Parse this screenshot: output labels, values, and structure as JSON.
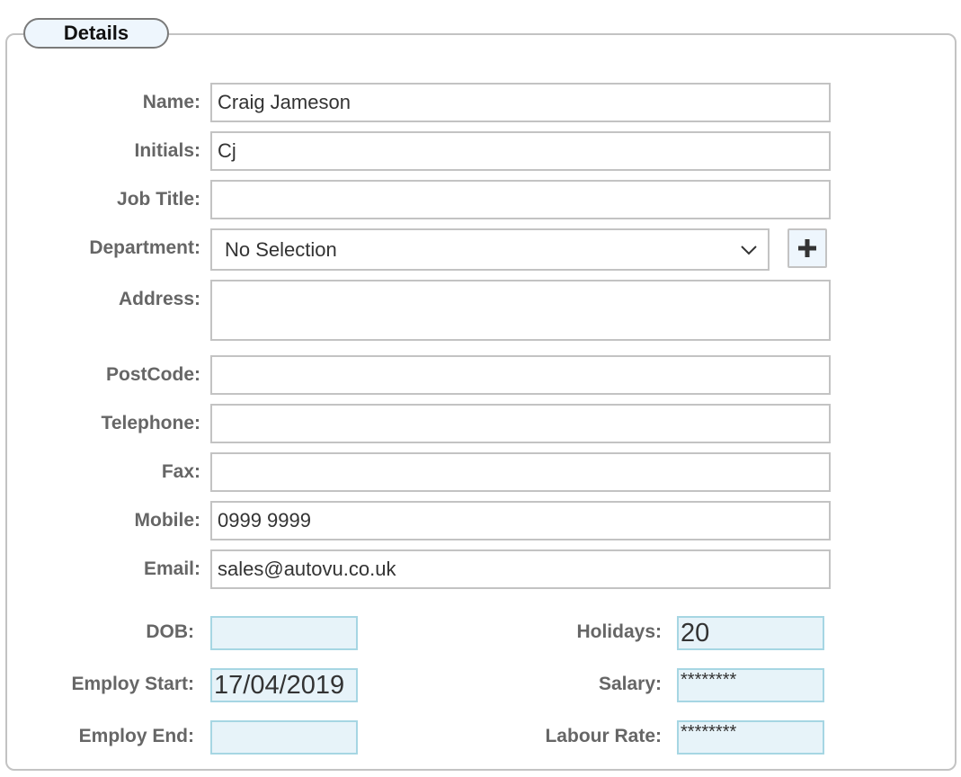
{
  "section": {
    "title": "Details"
  },
  "fields": {
    "name": {
      "label": "Name:",
      "value": "Craig Jameson"
    },
    "initials": {
      "label": "Initials:",
      "value": "Cj"
    },
    "job_title": {
      "label": "Job Title:",
      "value": ""
    },
    "department": {
      "label": "Department:",
      "value": "No Selection",
      "add_icon": "plus-icon",
      "dropdown_icon": "chevron-down-icon"
    },
    "address": {
      "label": "Address:",
      "value": ""
    },
    "postcode": {
      "label": "PostCode:",
      "value": ""
    },
    "telephone": {
      "label": "Telephone:",
      "value": ""
    },
    "fax": {
      "label": "Fax:",
      "value": ""
    },
    "mobile": {
      "label": "Mobile:",
      "value": "0999 9999"
    },
    "email": {
      "label": "Email:",
      "value": "sales@autovu.co.uk"
    },
    "dob": {
      "label": "DOB:",
      "value": ""
    },
    "employ_start": {
      "label": "Employ Start:",
      "value": "17/04/2019"
    },
    "employ_end": {
      "label": "Employ End:",
      "value": ""
    },
    "holidays": {
      "label": "Holidays:",
      "value": "20"
    },
    "salary": {
      "label": "Salary:",
      "value": "********"
    },
    "labour_rate": {
      "label": "Labour Rate:",
      "value": "********"
    }
  }
}
